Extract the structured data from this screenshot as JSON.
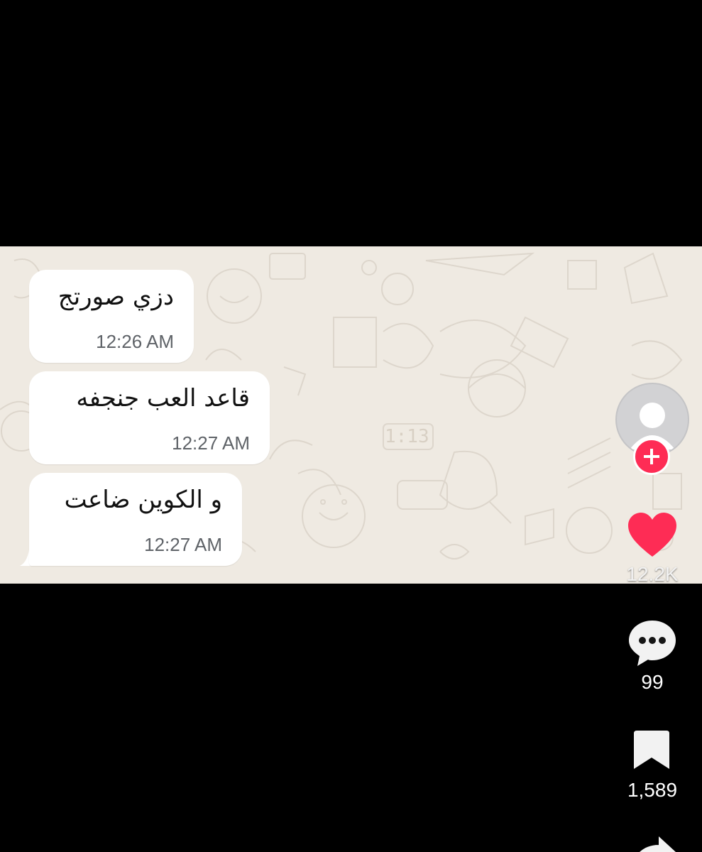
{
  "chat": {
    "messages": [
      {
        "text": "دزي صورتج",
        "time": "12:26 AM"
      },
      {
        "text": "قاعد العب جنجفه",
        "time": "12:27 AM"
      },
      {
        "text": "و الكوين ضاعت",
        "time": "12:27 AM"
      }
    ],
    "background_color": "#efeae2",
    "bubble_color": "#ffffff",
    "doodle_clock_text": "1:13"
  },
  "actions": {
    "avatar_icon": "user-placeholder-icon",
    "follow_icon": "plus-icon",
    "like": {
      "icon": "heart-icon",
      "count": "12.2K",
      "color": "#fe2c55"
    },
    "comment": {
      "icon": "comment-icon",
      "count": "99"
    },
    "save": {
      "icon": "bookmark-icon",
      "count": "1,589"
    },
    "share": {
      "icon": "share-arrow-icon"
    }
  }
}
